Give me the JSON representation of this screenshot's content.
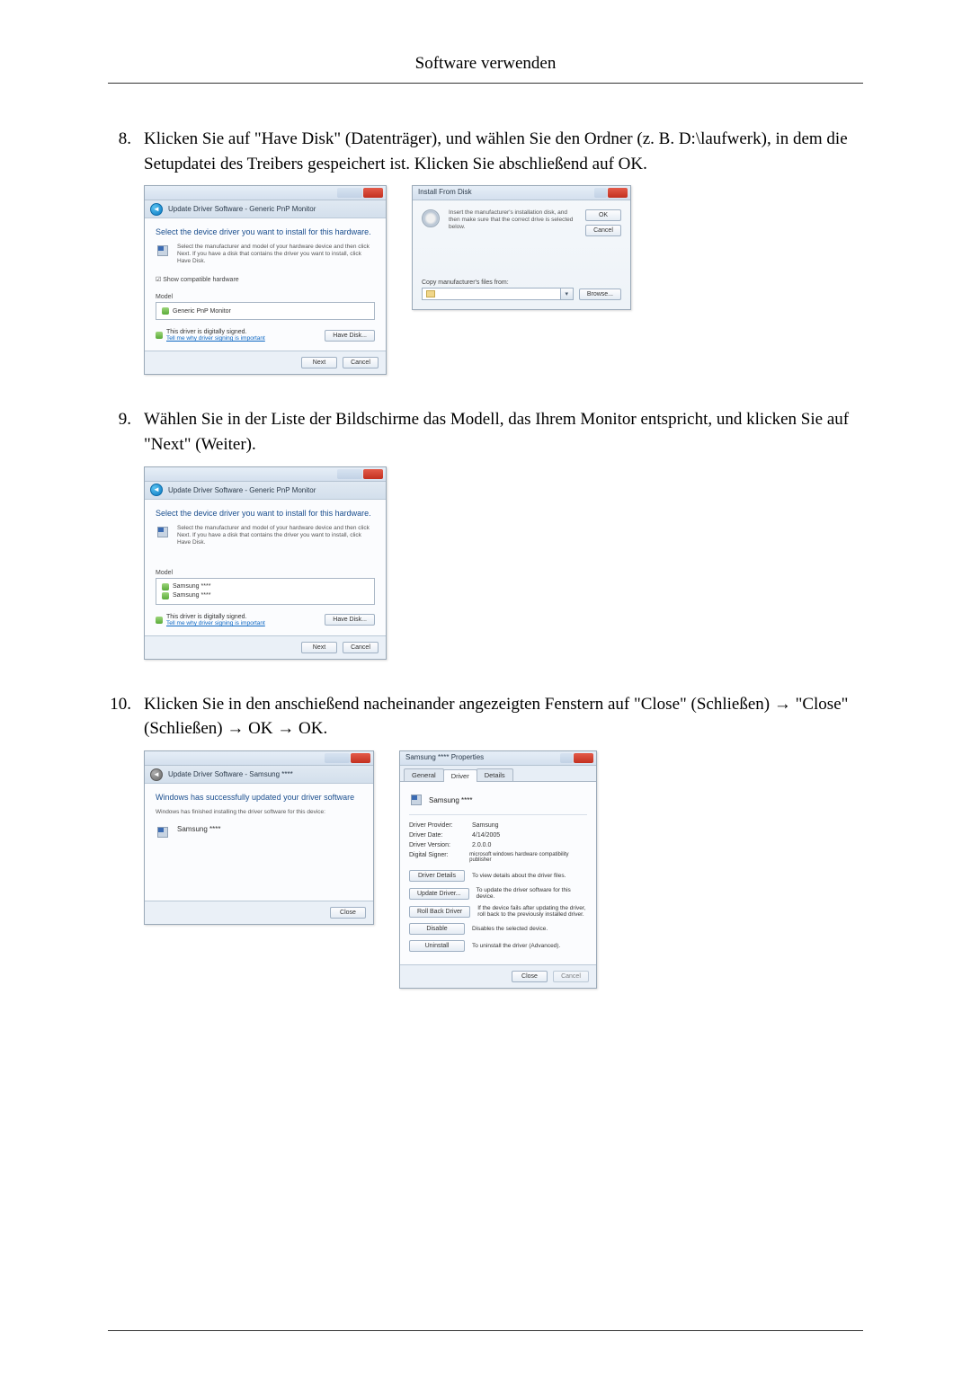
{
  "page": {
    "header": "Software verwenden"
  },
  "steps": {
    "s8": {
      "num": "8.",
      "text": "Klicken Sie auf \"Have Disk\" (Datenträger), und wählen Sie den Ordner (z. B. D:\\laufwerk), in dem die Setupdatei des Treibers gespeichert ist. Klicken Sie abschließend auf OK."
    },
    "s9": {
      "num": "9.",
      "text": "Wählen Sie in der Liste der Bildschirme das Modell, das Ihrem Monitor entspricht, und klicken Sie auf \"Next\" (Weiter)."
    },
    "s10": {
      "num": "10.",
      "text": "Klicken Sie in den anschießend nacheinander angezeigten Fenstern auf \"Close\" (Schließen) → \"Close\" (Schließen) → OK → OK."
    }
  },
  "shot8a": {
    "crumb": "Update Driver Software - Generic PnP Monitor",
    "headline": "Select the device driver you want to install for this hardware.",
    "instruction": "Select the manufacturer and model of your hardware device and then click Next. If you have a disk that contains the driver you want to install, click Have Disk.",
    "compat_label": "Show compatible hardware",
    "model_label": "Model",
    "model_item": "Generic PnP Monitor",
    "signed": "This driver is digitally signed.",
    "signed_link": "Tell me why driver signing is important",
    "have_disk_btn": "Have Disk...",
    "next_btn": "Next",
    "cancel_btn": "Cancel"
  },
  "shot8b": {
    "title": "Install From Disk",
    "text": "Insert the manufacturer's installation disk, and then make sure that the correct drive is selected below.",
    "copy_label": "Copy manufacturer's files from:",
    "ok_btn": "OK",
    "cancel_btn": "Cancel",
    "browse_btn": "Browse..."
  },
  "shot9": {
    "crumb": "Update Driver Software - Generic PnP Monitor",
    "headline": "Select the device driver you want to install for this hardware.",
    "instruction": "Select the manufacturer and model of your hardware device and then click Next. If you have a disk that contains the driver you want to install, click Have Disk.",
    "model_label": "Model",
    "model_item_a": "Samsung ****",
    "model_item_b": "Samsung ****",
    "signed": "This driver is digitally signed.",
    "signed_link": "Tell me why driver signing is important",
    "have_disk_btn": "Have Disk...",
    "next_btn": "Next",
    "cancel_btn": "Cancel"
  },
  "shot10a": {
    "crumb": "Update Driver Software - Samsung ****",
    "headline": "Windows has successfully updated your driver software",
    "sub": "Windows has finished installing the driver software for this device:",
    "device": "Samsung ****",
    "close_btn": "Close"
  },
  "shot10b": {
    "title": "Samsung **** Properties",
    "tabs": {
      "general": "General",
      "driver": "Driver",
      "details": "Details"
    },
    "device": "Samsung ****",
    "provider_k": "Driver Provider:",
    "provider_v": "Samsung",
    "date_k": "Driver Date:",
    "date_v": "4/14/2005",
    "version_k": "Driver Version:",
    "version_v": "2.0.0.0",
    "signer_k": "Digital Signer:",
    "signer_v": "microsoft windows hardware compatibility publisher",
    "driver_details_btn": "Driver Details",
    "driver_details_desc": "To view details about the driver files.",
    "update_btn": "Update Driver...",
    "update_desc": "To update the driver software for this device.",
    "rollback_btn": "Roll Back Driver",
    "rollback_desc": "If the device fails after updating the driver, roll back to the previously installed driver.",
    "disable_btn": "Disable",
    "disable_desc": "Disables the selected device.",
    "uninstall_btn": "Uninstall",
    "uninstall_desc": "To uninstall the driver (Advanced).",
    "close_btn": "Close",
    "cancel_btn": "Cancel"
  }
}
